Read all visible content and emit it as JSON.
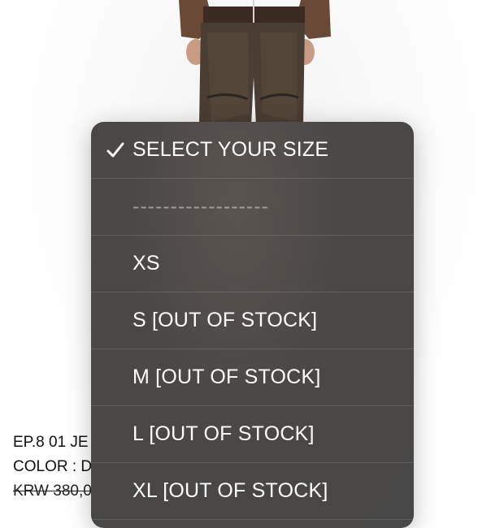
{
  "picker": {
    "options": [
      {
        "label": "SELECT YOUR SIZE",
        "selected": true
      },
      {
        "label": "------------------",
        "disabled": true
      },
      {
        "label": "XS"
      },
      {
        "label": "S [OUT OF STOCK]"
      },
      {
        "label": "M [OUT OF STOCK]"
      },
      {
        "label": "L [OUT OF STOCK]"
      },
      {
        "label": "XL [OUT OF STOCK]"
      }
    ]
  },
  "product": {
    "name": "EP.8 01 JE",
    "color": "COLOR : D",
    "price": "KRW 380,0"
  },
  "icons": {
    "selected": "checkmark-icon"
  }
}
